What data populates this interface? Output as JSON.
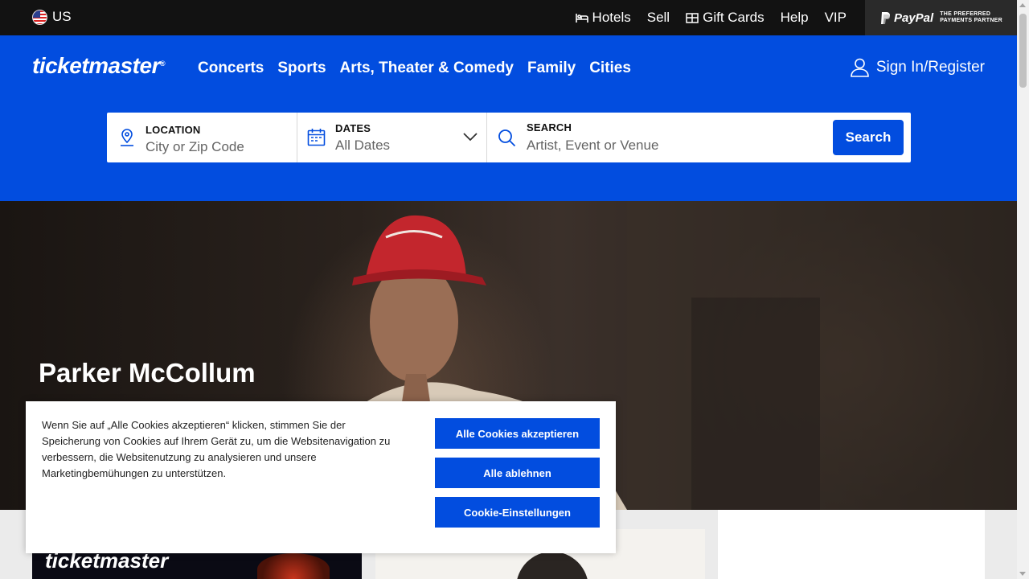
{
  "utility_bar": {
    "locale": "US",
    "links": [
      {
        "label": "Hotels",
        "icon": "bed-icon"
      },
      {
        "label": "Sell"
      },
      {
        "label": "Gift Cards",
        "icon": "gift-card-icon"
      },
      {
        "label": "Help"
      },
      {
        "label": "VIP"
      }
    ],
    "paypal": {
      "logo": "PayPal",
      "tagline_1": "THE PREFERRED",
      "tagline_2": "PAYMENTS PARTNER"
    }
  },
  "header": {
    "logo": "ticketmaster",
    "logo_mark": "®",
    "nav": [
      "Concerts",
      "Sports",
      "Arts, Theater & Comedy",
      "Family",
      "Cities"
    ],
    "sign_in": "Sign In/Register"
  },
  "search": {
    "location_label": "LOCATION",
    "location_placeholder": "City or Zip Code",
    "dates_label": "DATES",
    "dates_value": "All Dates",
    "search_label": "SEARCH",
    "search_placeholder": "Artist, Event or Venue",
    "button": "Search"
  },
  "hero": {
    "title": "Parker McCollum"
  },
  "cards": {
    "card1_logo": "ticketmaster"
  },
  "cookie_banner": {
    "text": "Wenn Sie auf „Alle Cookies akzeptieren“ klicken, stimmen Sie der Speicherung von Cookies auf Ihrem Gerät zu, um die Websitenavigation zu verbessern, die Websitenutzung zu analysieren und unsere Marketingbemühungen zu unterstützen.",
    "accept_all": "Alle Cookies akzeptieren",
    "reject_all": "Alle ablehnen",
    "settings": "Cookie-Einstellungen"
  },
  "colors": {
    "brand_blue": "#024ddf",
    "top_bar": "#121212",
    "paypal_bg": "#2a2a2a"
  }
}
